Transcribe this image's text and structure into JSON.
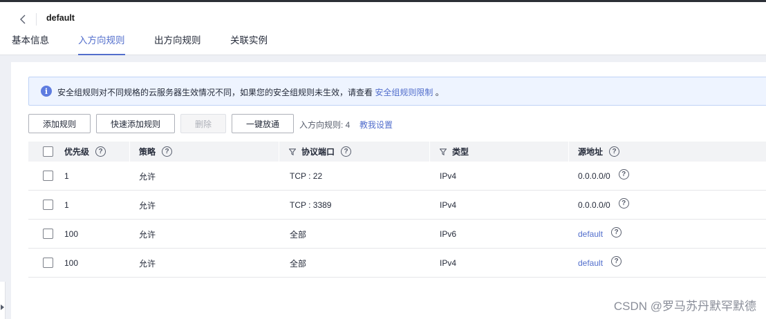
{
  "header": {
    "title": "default",
    "back_icon": "chevron-left-icon"
  },
  "tabs": [
    {
      "label": "基本信息",
      "active": false
    },
    {
      "label": "入方向规则",
      "active": true
    },
    {
      "label": "出方向规则",
      "active": false
    },
    {
      "label": "关联实例",
      "active": false
    }
  ],
  "notice": {
    "text": "安全组规则对不同规格的云服务器生效情况不同，如果您的安全组规则未生效，请查看",
    "link": "安全组规则限制",
    "suffix": "。"
  },
  "toolbar": {
    "add_rule": "添加规则",
    "quick_add": "快速添加规则",
    "delete": "删除",
    "one_click_allow": "一键放通",
    "rule_count_label": "入方向规则: 4",
    "teach_link": "教我设置"
  },
  "table": {
    "headers": {
      "priority": "优先级",
      "policy": "策略",
      "protocol_port": "协议端口",
      "type": "类型",
      "source": "源地址"
    },
    "rows": [
      {
        "priority": "1",
        "policy": "允许",
        "protocol_port": "TCP : 22",
        "type": "IPv4",
        "source": "0.0.0.0/0",
        "source_is_link": false
      },
      {
        "priority": "1",
        "policy": "允许",
        "protocol_port": "TCP : 3389",
        "type": "IPv4",
        "source": "0.0.0.0/0",
        "source_is_link": false
      },
      {
        "priority": "100",
        "policy": "允许",
        "protocol_port": "全部",
        "type": "IPv6",
        "source": "default",
        "source_is_link": true
      },
      {
        "priority": "100",
        "policy": "允许",
        "protocol_port": "全部",
        "type": "IPv4",
        "source": "default",
        "source_is_link": true
      }
    ]
  },
  "watermark": "CSDN @罗马苏丹默罕默德",
  "colors": {
    "accent": "#526ecc",
    "info_bg": "#eef4ff",
    "info_icon": "#5e7ce0"
  }
}
